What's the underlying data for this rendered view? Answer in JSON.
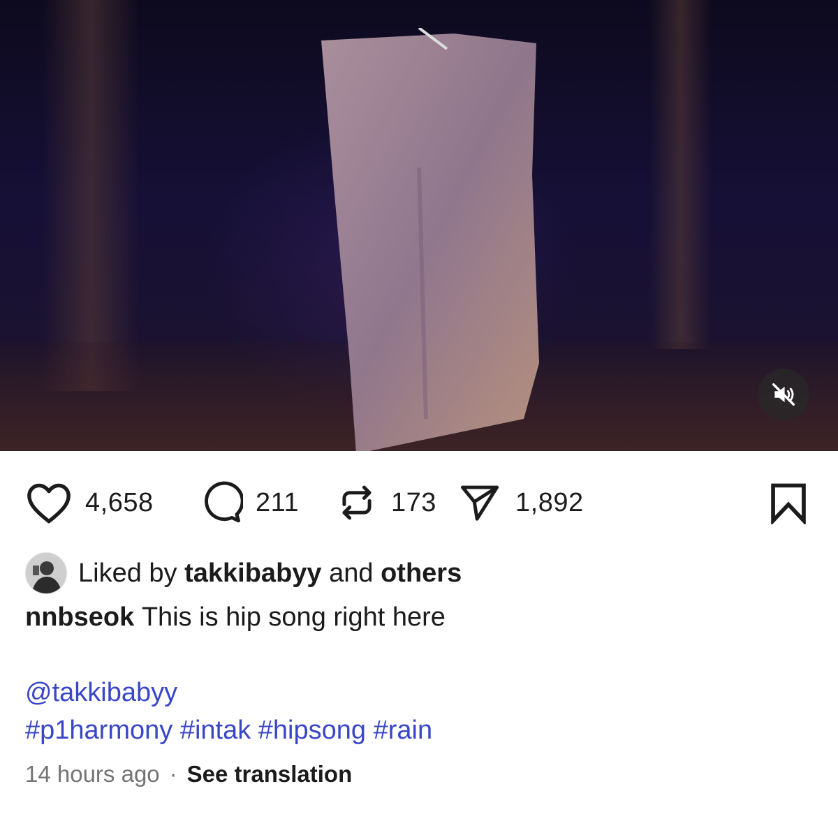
{
  "post": {
    "media": {
      "type": "video",
      "mute_icon": "speaker-muted-icon"
    },
    "actions": {
      "like": {
        "icon": "heart-icon",
        "count": "4,658"
      },
      "comment": {
        "icon": "comment-bubble-icon",
        "count": "211"
      },
      "repost": {
        "icon": "repost-arrows-icon",
        "count": "173"
      },
      "share": {
        "icon": "paper-plane-icon",
        "count": "1,892"
      },
      "save": {
        "icon": "bookmark-icon"
      }
    },
    "liked_by": {
      "prefix": "Liked by",
      "user": "takkibabyy",
      "middle": "and",
      "others": "others"
    },
    "caption": {
      "username": "nnbseok",
      "text": "This is hip song right here"
    },
    "mention": "@takkibabyy",
    "hashtags": [
      "#p1harmony",
      "#intak",
      "#hipsong",
      "#rain"
    ],
    "timestamp": "14 hours ago",
    "separator": "·",
    "translate_label": "See translation"
  },
  "colors": {
    "link": "#3a46c8",
    "text": "#1b1b1b",
    "muted": "#737373"
  }
}
